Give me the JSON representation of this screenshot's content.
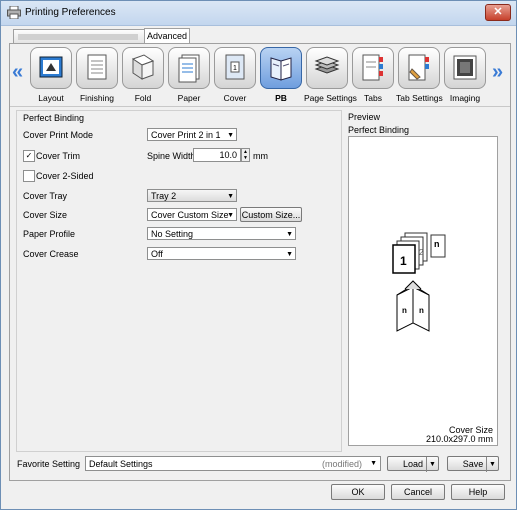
{
  "window": {
    "title": "Printing Preferences",
    "close": "✕"
  },
  "tabs": {
    "advanced": "Advanced"
  },
  "ribbon": {
    "items": [
      {
        "label": "Layout",
        "icon": "layout-icon"
      },
      {
        "label": "Finishing",
        "icon": "finishing-icon"
      },
      {
        "label": "Fold",
        "icon": "fold-icon"
      },
      {
        "label": "Paper",
        "icon": "paper-icon"
      },
      {
        "label": "Cover",
        "icon": "cover-icon"
      },
      {
        "label": "PB",
        "icon": "perfect-binding-icon",
        "selected": true
      },
      {
        "label": "Page Settings",
        "icon": "page-settings-icon"
      },
      {
        "label": "Tabs",
        "icon": "tabs-icon"
      },
      {
        "label": "Tab Settings",
        "icon": "tab-settings-icon"
      },
      {
        "label": "Imaging",
        "icon": "imaging-icon"
      }
    ],
    "left_arrow": "«",
    "right_arrow": "»"
  },
  "binding": {
    "title": "Perfect Binding",
    "cover_print_mode_label": "Cover Print Mode",
    "cover_print_mode_value": "Cover Print 2 in 1",
    "cover_trim_label": "Cover Trim",
    "cover_trim_checked": true,
    "spine_width_label": "Spine Width",
    "spine_width_value": "10.0",
    "spine_width_unit": "mm",
    "cover_2sided_label": "Cover 2-Sided",
    "cover_2sided_checked": false,
    "cover_tray_label": "Cover Tray",
    "cover_tray_value": "Tray 2",
    "cover_size_label": "Cover Size",
    "cover_size_value": "Cover Custom Size",
    "custom_size_button": "Custom Size...",
    "paper_profile_label": "Paper Profile",
    "paper_profile_value": "No Setting",
    "cover_crease_label": "Cover Crease",
    "cover_crease_value": "Off"
  },
  "preview": {
    "title": "Preview",
    "subtitle": "Perfect Binding",
    "cover_size_label": "Cover Size",
    "cover_size_value": "210.0x297.0 mm"
  },
  "footer": {
    "favorite_label": "Favorite Setting",
    "favorite_value": "Default Settings",
    "modified": "(modified)",
    "load": "Load",
    "save": "Save",
    "ok": "OK",
    "cancel": "Cancel",
    "help": "Help"
  },
  "colors": {
    "accent": "#3a7bd5",
    "titlebar": "#c3d6ee",
    "close": "#c6402b"
  }
}
